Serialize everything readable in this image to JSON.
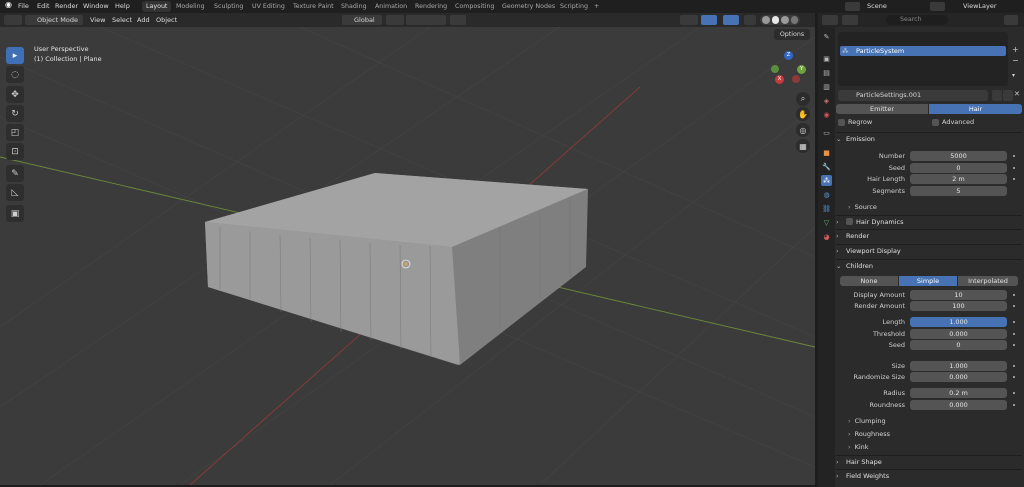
{
  "menu": [
    "File",
    "Edit",
    "Render",
    "Window",
    "Help"
  ],
  "workspaces": [
    "Layout",
    "Modeling",
    "Sculpting",
    "UV Editing",
    "Texture Paint",
    "Shading",
    "Animation",
    "Rendering",
    "Compositing",
    "Geometry Nodes",
    "Scripting"
  ],
  "active_workspace": "Layout",
  "scene": "Scene",
  "view_layer": "ViewLayer",
  "viewport_header": {
    "mode": "Object Mode",
    "menus": [
      "View",
      "Select",
      "Add",
      "Object"
    ],
    "transform": "Global",
    "options": "Options"
  },
  "viewport_info": {
    "line1": "User Perspective",
    "line2": "(1) Collection | Plane"
  },
  "gizmo": {
    "x": "X",
    "y": "Y",
    "z": "Z"
  },
  "outliner": {
    "search_placeholder": "Search"
  },
  "particle_system": "ParticleSystem",
  "particle_settings": "ParticleSettings.001",
  "type_tabs": [
    "Emitter",
    "Hair"
  ],
  "regrow": "Regrow",
  "advanced": "Advanced",
  "emission": {
    "header": "Emission",
    "number_label": "Number",
    "number": "5000",
    "seed_label": "Seed",
    "seed": "0",
    "hair_length_label": "Hair Length",
    "hair_length": "2 m",
    "segments_label": "Segments",
    "segments": "5",
    "source": "Source"
  },
  "sections": {
    "hair_dynamics": "Hair Dynamics",
    "render": "Render",
    "viewport_display": "Viewport Display",
    "children": "Children"
  },
  "children": {
    "tabs": [
      "None",
      "Simple",
      "Interpolated"
    ],
    "display_amount_label": "Display Amount",
    "display_amount": "10",
    "render_amount_label": "Render Amount",
    "render_amount": "100",
    "length_label": "Length",
    "length": "1.000",
    "threshold_label": "Threshold",
    "threshold": "0.000",
    "seed_label": "Seed",
    "seed": "0",
    "size_label": "Size",
    "size": "1.000",
    "randomize_size_label": "Randomize Size",
    "randomize_size": "0.000",
    "radius_label": "Radius",
    "radius": "0.2 m",
    "roundness_label": "Roundness",
    "roundness": "0.000",
    "clumping": "Clumping",
    "roughness": "Roughness",
    "kink": "Kink"
  },
  "bottom_sections": {
    "hair_shape": "Hair Shape",
    "field_weights": "Field Weights"
  }
}
